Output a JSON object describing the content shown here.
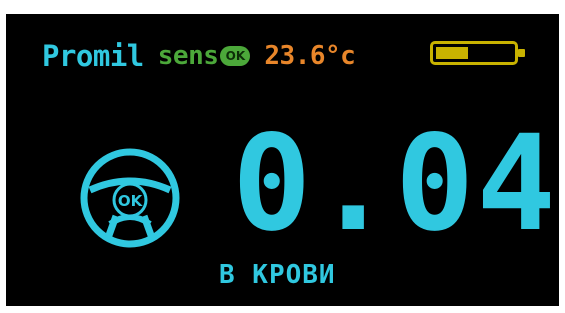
{
  "status_bar": {
    "app_name": "Promil",
    "sensor_label": "sens",
    "sensor_status": "OK",
    "temperature": "23.6°c",
    "battery_level": 0.42
  },
  "main": {
    "status_icon": "steering-wheel-icon",
    "status_icon_text": "OK",
    "reading_value": "0.04",
    "reading_unit": "В КРОВИ"
  },
  "colors": {
    "background": "#000000",
    "primary": "#30c8e0",
    "sensor_ok": "#4ca83a",
    "temperature": "#e8862a",
    "battery": "#c8b200"
  }
}
